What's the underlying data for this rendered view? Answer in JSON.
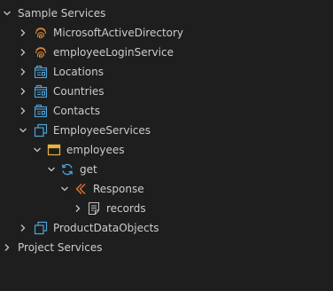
{
  "tree": {
    "sample_services": "Sample Services",
    "microsoft_active_directory": "MicrosoftActiveDirectory",
    "employee_login_service": "employeeLoginService",
    "locations": "Locations",
    "countries": "Countries",
    "contacts": "Contacts",
    "employee_services": "EmployeeServices",
    "employees": "employees",
    "get": "get",
    "response": "Response",
    "records": "records",
    "product_data_objects": "ProductDataObjects",
    "project_services": "Project Services"
  },
  "icons": {
    "fingerprint": "fingerprint-icon",
    "crud_service": "crud-service-icon",
    "object_service": "object-service-icon",
    "model": "model-icon",
    "operation": "operation-icon",
    "response": "response-icon",
    "field": "field-icon"
  },
  "colors": {
    "background": "#1e1e1e",
    "text": "#cccccc",
    "fingerprint": "#d9852e",
    "service": "#4fa3d9",
    "model": "#e5b33d",
    "response": "#e0742f"
  }
}
